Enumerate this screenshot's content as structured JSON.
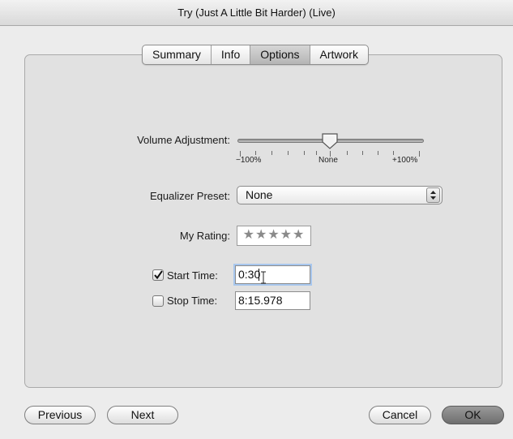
{
  "window": {
    "title": "Try (Just A Little Bit Harder) (Live)"
  },
  "tabs": [
    {
      "label": "Summary",
      "selected": false
    },
    {
      "label": "Info",
      "selected": false
    },
    {
      "label": "Options",
      "selected": true
    },
    {
      "label": "Artwork",
      "selected": false
    }
  ],
  "options": {
    "volume": {
      "label": "Volume Adjustment:",
      "min_label": "−100%",
      "mid_label": "None",
      "max_label": "+100%",
      "value_percent": 0
    },
    "equalizer": {
      "label": "Equalizer Preset:",
      "value": "None"
    },
    "rating": {
      "label": "My Rating:",
      "stars": "★★★★★",
      "value": 0
    },
    "start_time": {
      "label": "Start Time:",
      "checked": true,
      "value": "0:30"
    },
    "stop_time": {
      "label": "Stop Time:",
      "checked": false,
      "value": "8:15.978"
    }
  },
  "buttons": {
    "previous": "Previous",
    "next": "Next",
    "cancel": "Cancel",
    "ok": "OK"
  },
  "colors": {
    "selected_tab": "#bdbdbd",
    "default_button": "#7a7a7a",
    "focus_ring": "#a8c7ee"
  }
}
